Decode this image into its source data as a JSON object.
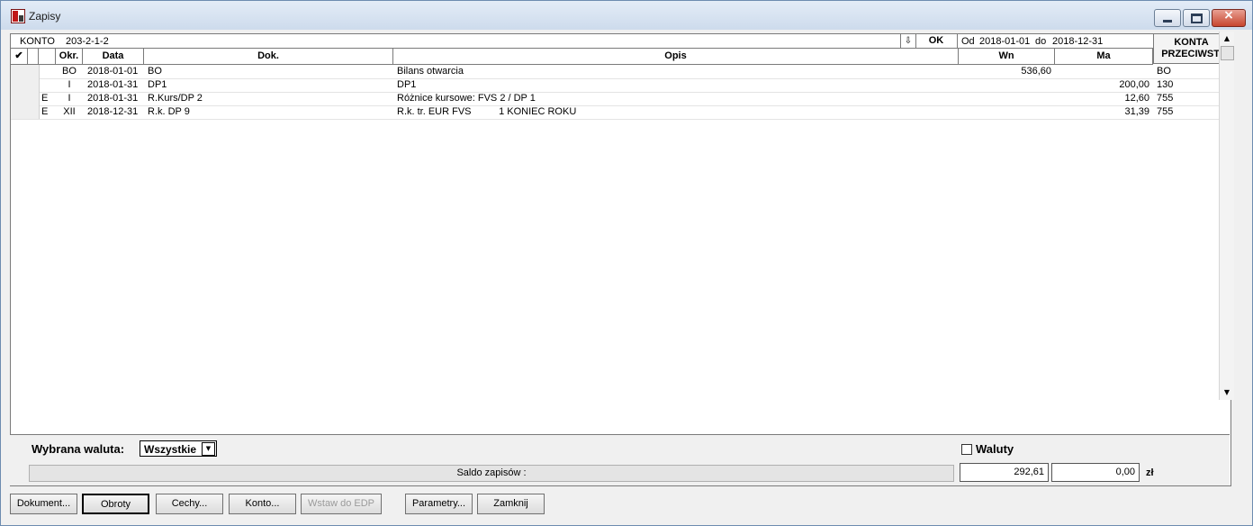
{
  "window": {
    "title": "Zapisy"
  },
  "header": {
    "konto_label": "KONTO",
    "konto_value": "203-2-1-2",
    "ok_label": "OK",
    "od_label": "Od",
    "od_value": "2018-01-01",
    "do_label": "do",
    "do_value": "2018-12-31",
    "konta_line1": "KONTA",
    "konta_line2": "PRZECIWST."
  },
  "columns": {
    "check": "✔",
    "okr": "Okr.",
    "data": "Data",
    "dok": "Dok.",
    "opis": "Opis",
    "wn": "Wn",
    "ma": "Ma"
  },
  "rows": [
    {
      "flag": "",
      "okr": "BO",
      "data": "2018-01-01",
      "dok": "BO",
      "opis": "Bilans otwarcia",
      "wn": "536,60",
      "ma": "",
      "konta": "BO"
    },
    {
      "flag": "",
      "okr": "I",
      "data": "2018-01-31",
      "dok": "DP1",
      "opis": "DP1",
      "wn": "",
      "ma": "200,00",
      "konta": "130"
    },
    {
      "flag": "E",
      "okr": "I",
      "data": "2018-01-31",
      "dok": "R.Kurs/DP 2",
      "opis": "Różnice kursowe: FVS 2 / DP 1",
      "wn": "",
      "ma": "12,60",
      "konta": "755"
    },
    {
      "flag": "E",
      "okr": "XII",
      "data": "2018-12-31",
      "dok": "R.k. DP 9",
      "opis": "R.k. tr. EUR FVS          1 KONIEC ROKU",
      "wn": "",
      "ma": "31,39",
      "konta": "755"
    }
  ],
  "filters": {
    "waluta_label": "Wybrana waluta:",
    "waluta_value": "Wszystkie",
    "waluty_label": "Waluty",
    "waluty_checked": false
  },
  "saldo": {
    "label": "Saldo zapisów :",
    "wn": "292,61",
    "ma": "0,00",
    "currency": "zł"
  },
  "buttons": {
    "dokument": "Dokument...",
    "obroty": "Obroty",
    "cechy": "Cechy...",
    "konto": "Konto...",
    "edp": "Wstaw do EDP",
    "parametry": "Parametry...",
    "zamknij": "Zamknij"
  },
  "icons": {
    "app": "app-document-icon",
    "minimize": "minimize-icon",
    "maximize": "maximize-icon",
    "close": "close-icon",
    "download": "download-arrow-icon"
  }
}
